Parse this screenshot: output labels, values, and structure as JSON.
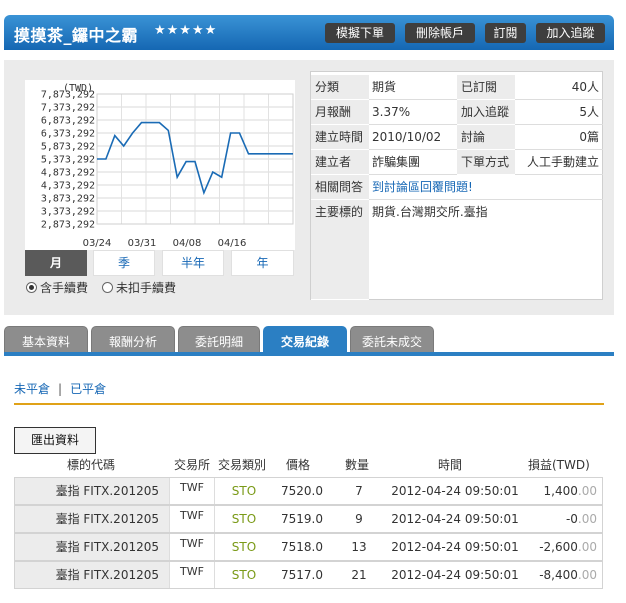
{
  "header": {
    "title": "摸摸茶_鑼中之霸",
    "stars": "★★★★★",
    "buttons": [
      "模擬下單",
      "刪除帳戶",
      "訂閱",
      "加入追蹤"
    ]
  },
  "chart_data": {
    "type": "line",
    "unit_label": "(TWD)",
    "y_ticks": [
      "7,873,292",
      "7,373,292",
      "6,873,292",
      "6,373,292",
      "5,873,292",
      "5,373,292",
      "4,873,292",
      "4,373,292",
      "3,873,292",
      "3,373,292",
      "2,873,292"
    ],
    "x_ticks": [
      "03/24",
      "03/31",
      "04/08",
      "04/16"
    ],
    "ylim": [
      2873292,
      7873292
    ],
    "series": [
      {
        "color": "#1a6bb5",
        "values": [
          5373292,
          5373292,
          6273292,
          5873292,
          6373292,
          6773292,
          6773292,
          6773292,
          6473292,
          4673292,
          5273292,
          5273292,
          4073292,
          4873292,
          4673292,
          6373292,
          6373292,
          5573292,
          5573292,
          5573292,
          5573292,
          5573292,
          5573292
        ]
      }
    ],
    "grid": true
  },
  "period_tabs": [
    "月",
    "季",
    "半年",
    "年"
  ],
  "period_active": "月",
  "fee_options": {
    "include": "含手續費",
    "exclude": "未扣手續費",
    "selected": "include"
  },
  "info": {
    "category_label": "分類",
    "category": "期貨",
    "subscribed_label": "已訂閱",
    "subscribed": "40人",
    "monthly_return_label": "月報酬",
    "monthly_return": "3.37%",
    "follow_label": "加入追蹤",
    "follow": "5人",
    "created_label": "建立時間",
    "created": "2010/10/02",
    "discussion_label": "討論",
    "discussion": "0篇",
    "creator_label": "建立者",
    "creator": "詐騙集團",
    "order_method_label": "下單方式",
    "order_method": "人工手動建立",
    "qa_label": "相關問答",
    "qa_link": "到討論區回覆問題!",
    "target_label": "主要標的",
    "target": "期貨.台灣期交所.臺指"
  },
  "tabs": [
    "基本資料",
    "報酬分析",
    "委託明細",
    "交易紀錄",
    "委託未成交"
  ],
  "tab_active": "交易紀錄",
  "subnav": {
    "open": "未平倉",
    "sep": "|",
    "closed": "已平倉"
  },
  "export_label": "匯出資料",
  "table": {
    "headers": [
      "標的代碼",
      "交易所",
      "交易類別",
      "價格",
      "數量",
      "時間",
      "損益(TWD)"
    ],
    "rows": [
      {
        "symbol": "臺指 FITX.201205",
        "exchange": "TWF",
        "type": "STO",
        "price": "7520.0",
        "qty": "7",
        "time": "2012-04-24 09:50:01",
        "pnl": "1,400",
        "pnl_dec": ".00"
      },
      {
        "symbol": "臺指 FITX.201205",
        "exchange": "TWF",
        "type": "STO",
        "price": "7519.0",
        "qty": "9",
        "time": "2012-04-24 09:50:01",
        "pnl": "-0",
        "pnl_dec": ".00"
      },
      {
        "symbol": "臺指 FITX.201205",
        "exchange": "TWF",
        "type": "STO",
        "price": "7518.0",
        "qty": "13",
        "time": "2012-04-24 09:50:01",
        "pnl": "-2,600",
        "pnl_dec": ".00"
      },
      {
        "symbol": "臺指 FITX.201205",
        "exchange": "TWF",
        "type": "STO",
        "price": "7517.0",
        "qty": "21",
        "time": "2012-04-24 09:50:01",
        "pnl": "-8,400",
        "pnl_dec": ".00"
      }
    ]
  }
}
